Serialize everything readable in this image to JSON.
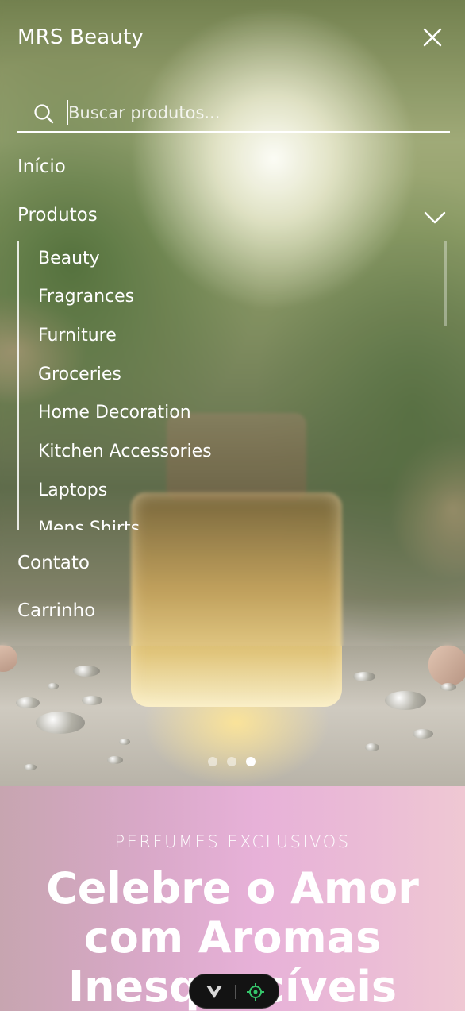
{
  "menu": {
    "brand": "MRS Beauty",
    "search": {
      "placeholder": "Buscar produtos...",
      "value": ""
    },
    "nav": {
      "home": "Início",
      "products": "Produtos",
      "contact": "Contato",
      "cart": "Carrinho"
    },
    "products_submenu": [
      "Beauty",
      "Fragrances",
      "Furniture",
      "Groceries",
      "Home Decoration",
      "Kitchen Accessories",
      "Laptops",
      "Mens Shirts"
    ]
  },
  "carousel": {
    "slide_count": 3,
    "active_index": 2
  },
  "promo": {
    "kicker": "PERFUMES EXCLUSIVOS",
    "title": "Celebre o Amor com Aromas Inesquecíveis"
  },
  "colors": {
    "promo_gradient_start": "#c7a5b0",
    "promo_gradient_mid": "#e7b1d8",
    "promo_gradient_end": "#efc8d3",
    "toolbar_bg": "#131313",
    "toolbar_target": "#35c46a"
  },
  "icons": {
    "close": "close-icon",
    "search": "search-icon",
    "expand": "chevron-down-icon",
    "toolbar_left": "v-logo-icon",
    "toolbar_right": "target-icon"
  }
}
